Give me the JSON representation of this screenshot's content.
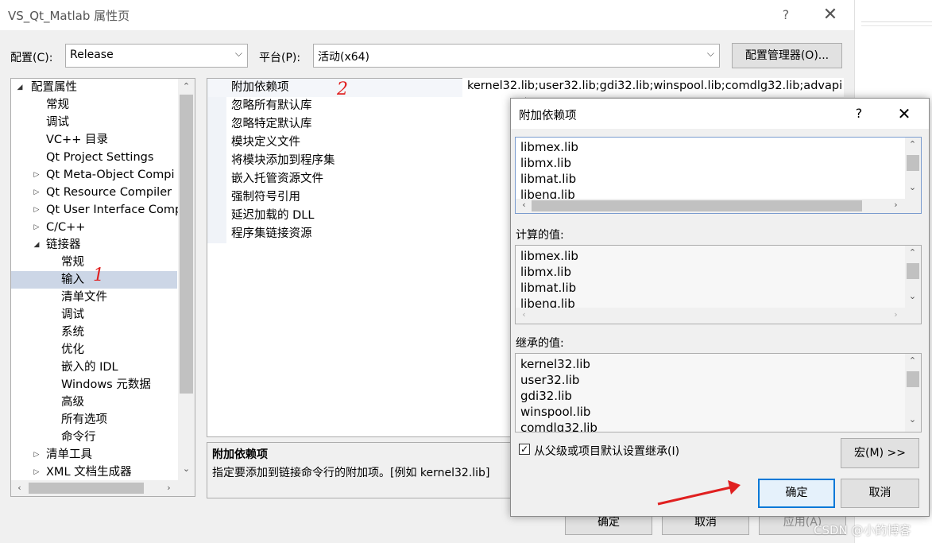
{
  "window": {
    "title": "VS_Qt_Matlab 属性页",
    "help": "?",
    "close": "✕"
  },
  "config": {
    "label": "配置(C):",
    "value": "Release"
  },
  "platform": {
    "label": "平台(P):",
    "value": "活动(x64)"
  },
  "config_manager_label": "配置管理器(O)...",
  "tree": {
    "root": "配置属性",
    "items": [
      "常规",
      "调试",
      "VC++ 目录",
      "Qt Project Settings",
      "Qt Meta-Object Compi",
      "Qt Resource Compiler",
      "Qt User Interface Comp",
      "C/C++",
      "链接器",
      "常规",
      "输入",
      "清单文件",
      "调试",
      "系统",
      "优化",
      "嵌入的 IDL",
      "Windows 元数据",
      "高级",
      "所有选项",
      "命令行",
      "清单工具",
      "XML 文档生成器"
    ]
  },
  "properties": [
    "附加依赖项",
    "忽略所有默认库",
    "忽略特定默认库",
    "模块定义文件",
    "将模块添加到程序集",
    "嵌入托管资源文件",
    "强制符号引用",
    "延迟加载的 DLL",
    "程序集链接资源"
  ],
  "first_value": "kernel32.lib;user32.lib;gdi32.lib;winspool.lib;comdlg32.lib;advapi",
  "description": {
    "title": "附加依赖项",
    "text": "指定要添加到链接命令行的附加项。[例如 kernel32.lib]"
  },
  "bottom_buttons": {
    "ok": "确定",
    "cancel": "取消",
    "apply": "应用(A)"
  },
  "annotations": {
    "mark1": "1",
    "mark2": "2"
  },
  "dialog": {
    "title": "附加依赖项",
    "help": "?",
    "close": "✕",
    "edit_items": [
      "libmex.lib",
      "libmx.lib",
      "libmat.lib",
      "libeng.lib"
    ],
    "computed_label": "计算的值:",
    "computed_items": [
      "libmex.lib",
      "libmx.lib",
      "libmat.lib",
      "libeng.lib"
    ],
    "inherited_label": "继承的值:",
    "inherited_items": [
      "kernel32.lib",
      "user32.lib",
      "gdi32.lib",
      "winspool.lib",
      "comdlg32.lib"
    ],
    "inherit_checkbox": "从父级或项目默认设置继承(I)",
    "inherit_checked": true,
    "macro_button": "宏(M) >>",
    "ok": "确定",
    "cancel": "取消"
  },
  "watermark": "CSDN @小的博客",
  "colors": {
    "selection": "#ccd6e6",
    "arrow": "#e02020",
    "accent": "#0078d7"
  }
}
